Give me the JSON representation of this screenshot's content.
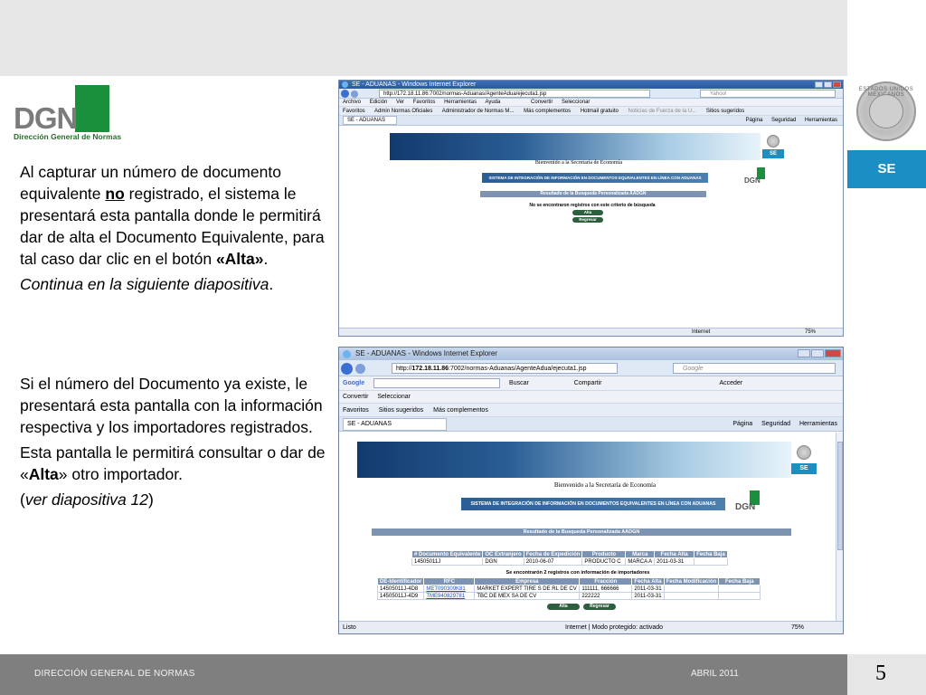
{
  "logo": {
    "letters": "DGN",
    "subtitle": "Dirección General de Normas"
  },
  "side": {
    "se_badge": "SE",
    "seal_text": "ESTADOS UNIDOS MEXICANOS"
  },
  "text1": {
    "p1_a": "Al capturar un número de documento equivalente ",
    "p1_no": "no",
    "p1_b": " registrado, el sistema le presentará esta pantalla  donde le permitirá dar de alta el Documento Equivalente, para tal caso dar clic en el botón ",
    "p1_alta": "«Alta»",
    "p1_c": ".",
    "p2": "Continua en la siguiente diapositiva",
    "p2_end": "."
  },
  "text2": {
    "p1": "Si el número del Documento ya existe, le presentará esta pantalla con la información respectiva y los importadores registrados.",
    "p2_a": "Esta pantalla le permitirá consultar o dar de «",
    "p2_alta": "Alta",
    "p2_b": "» otro importador.",
    "p3_a": "(",
    "p3_i": "ver diapositiva 12",
    "p3_b": ")"
  },
  "shot1": {
    "title": "SE - ADUANAS - Windows Internet Explorer",
    "url": "http://172.18.11.86:7002/normas-Aduanas/AgenteAdua/ejecuta1.jsp",
    "search": "Yahoo!",
    "menu": [
      "Archivo",
      "Edición",
      "Ver",
      "Favoritos",
      "Herramientas",
      "Ayuda",
      "Convertir",
      "Seleccionar"
    ],
    "favs": [
      "Favoritos",
      "Admin Normas Oficiales",
      "Administrador de Normas M...",
      "Más complementos",
      "Hotmail gratuito",
      "Noticias de Fuerza de la U...",
      "Sitios sugeridos"
    ],
    "tab": "SE - ADUANAS",
    "tools": [
      "Página",
      "Seguridad",
      "Herramientas"
    ],
    "welcome": "Bienvenido a la Secretaría de Economía",
    "system": "SISTEMA DE INTEGRACIÓN DE INFORMACIÓN EN DOCUMENTOS EQUIVALENTES EN LÍNEA CON ADUANAS",
    "result": "Resultado de la Busqueda Personalizada AADGN",
    "msg": "No se encontraron registros con este criterio de búsqueda",
    "btn_alta": "Alta",
    "btn_regresar": "Regresar",
    "se": "SE",
    "dgn": "DGN",
    "status_internet": "Internet",
    "zoom": "75%"
  },
  "shot2": {
    "title": "SE - ADUANAS - Windows Internet Explorer",
    "url_a": "http://",
    "url_b": "172.18.11.86",
    "url_c": ":7002/normas-Aduanas/AgenteAdua/ejecuta1.jsp",
    "search": "Google",
    "google_bar": [
      "Google",
      "Buscar",
      "Compartir",
      "Acceder"
    ],
    "conv": [
      "Convertir",
      "Seleccionar"
    ],
    "favs": [
      "Favoritos",
      "Sitios sugeridos",
      "Más complementos"
    ],
    "tab": "SE - ADUANAS",
    "tools": [
      "Página",
      "Seguridad",
      "Herramientas"
    ],
    "welcome": "Bienvenido a la Secretaría de Economía",
    "system": "SISTEMA DE INTEGRACIÓN DE INFORMACIÓN EN DOCUMENTOS EQUIVALENTES EN LÍNEA CON ADUANAS",
    "result": "Resultado de la Busqueda Personalizada AADGN",
    "se": "SE",
    "dgn": "DGN",
    "doc_headers": [
      "# Documento Equivalente",
      "OC Extranjero",
      "Fecha de Expedición",
      "Producto",
      "Marca",
      "Fecha Alta",
      "Fecha Baja"
    ],
    "doc_row": [
      "14505011J",
      "DGN",
      "2010-06-07",
      "PRODUCTO C",
      "MARCA A",
      "2011-03-31",
      ""
    ],
    "found_msg": "Se encontrarón 2 registros con información de importadores",
    "imp_headers": [
      "DE-Identificador",
      "RFC",
      "Empresa",
      "Fracción",
      "Fecha Alta",
      "Fecha Modificación",
      "Fecha Baja"
    ],
    "imp_rows": [
      [
        "14505011J-4D8",
        "MET090309K81",
        "MARKET EXPERT TIRE S DE RL DE CV",
        "111111, 666666",
        "2011-03-31",
        "",
        ""
      ],
      [
        "14505011J-4D9",
        "TME940829781",
        "TBC DE MEX SA DE CV",
        "222222",
        "2011-03-31",
        "",
        ""
      ]
    ],
    "btn_alta": "Alta",
    "btn_regresar": "Regresar",
    "status_left": "Listo",
    "status_mid": "Internet | Modo protegido: activado",
    "zoom": "75%"
  },
  "footer": {
    "left": "DIRECCIÓN GENERAL DE NORMAS",
    "right": "ABRIL 2011",
    "page": "5"
  }
}
